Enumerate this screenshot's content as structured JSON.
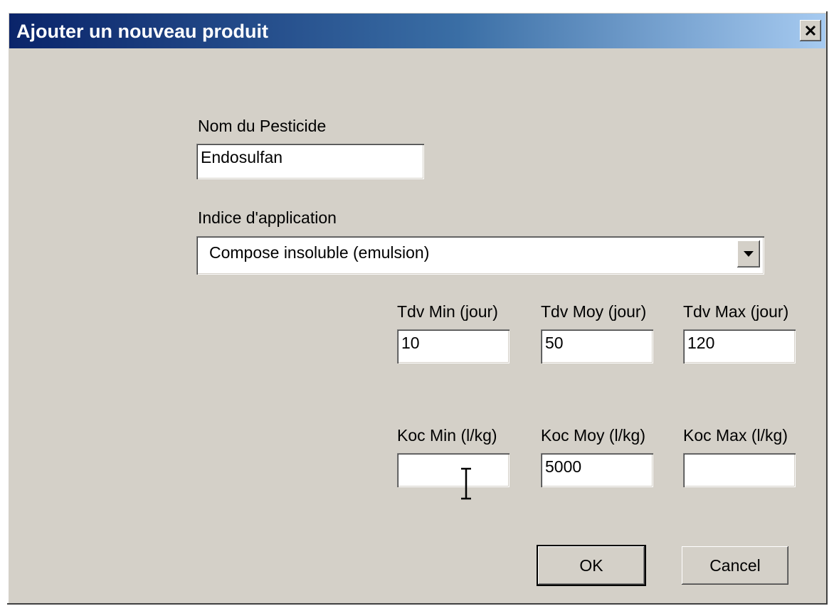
{
  "dialog": {
    "title": "Ajouter un nouveau produit",
    "close_icon": "close-icon"
  },
  "pesticide": {
    "label": "Nom du Pesticide",
    "value": "Endosulfan"
  },
  "application": {
    "label": "Indice d'application",
    "selected": "Compose insoluble (emulsion)",
    "arrow_icon": "chevron-down-icon"
  },
  "tdv": {
    "min_label": "Tdv Min (jour)",
    "min_value": "10",
    "moy_label": "Tdv Moy (jour)",
    "moy_value": "50",
    "max_label": "Tdv Max (jour)",
    "max_value": "120"
  },
  "koc": {
    "min_label": "Koc Min (l/kg)",
    "min_value": "",
    "moy_label": "Koc Moy (l/kg)",
    "moy_value": "5000",
    "max_label": "Koc Max (l/kg)",
    "max_value": ""
  },
  "buttons": {
    "ok": "OK",
    "cancel": "Cancel"
  },
  "colors": {
    "dialog_bg": "#d4d0c8",
    "title_gradient_start": "#0a246a",
    "title_gradient_end": "#a6caf0"
  }
}
